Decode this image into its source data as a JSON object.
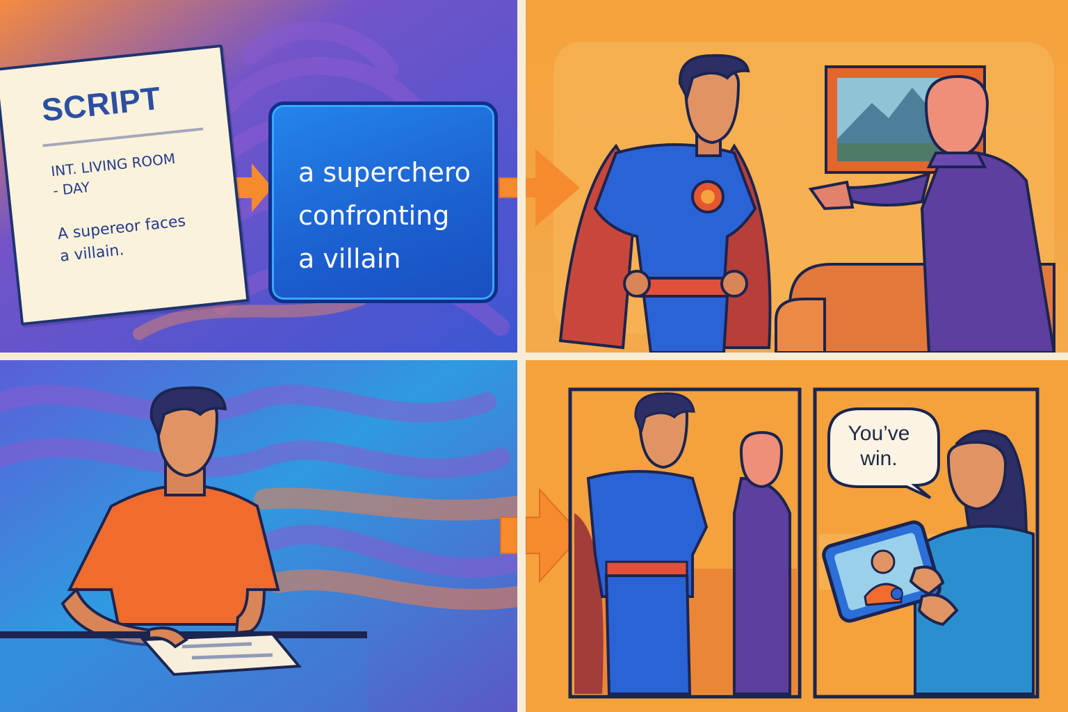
{
  "script_card": {
    "title": "SCRIPT",
    "scene_heading": "INT. LIVING ROOM\n   - DAY",
    "action": "A supereor faces\na villain."
  },
  "prompt_box": {
    "text": "a superchero\nconfronting\na villain"
  },
  "speech_bubble": {
    "text": "You’ve\nwin."
  },
  "colors": {
    "background_blue": "#3f5fd6",
    "background_orange": "#f7a543",
    "hero_suit": "#2a63d6",
    "hero_cape": "#d9503a",
    "villain_suit": "#5c3f9e",
    "outline": "#1c2450",
    "arrow": "#f68a2e"
  },
  "icons": [
    "arrow-right-icon",
    "arrow-right-icon",
    "arrow-right-icon",
    "arrow-right-icon"
  ]
}
